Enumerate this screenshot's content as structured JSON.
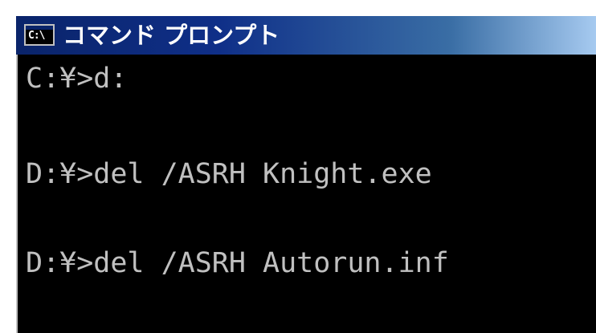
{
  "window": {
    "title": "コマンド プロンプト",
    "icon_label": "C:\\",
    "icon": "cmd-icon"
  },
  "console": {
    "lines": [
      "C:¥>d:",
      "",
      "D:¥>del /ASRH Knight.exe",
      "",
      "D:¥>del /ASRH Autorun.inf"
    ]
  },
  "colors": {
    "titlebar_start": "#0a246a",
    "titlebar_end": "#a6caf0",
    "console_bg": "#000000",
    "console_text": "#c0c0c0"
  }
}
